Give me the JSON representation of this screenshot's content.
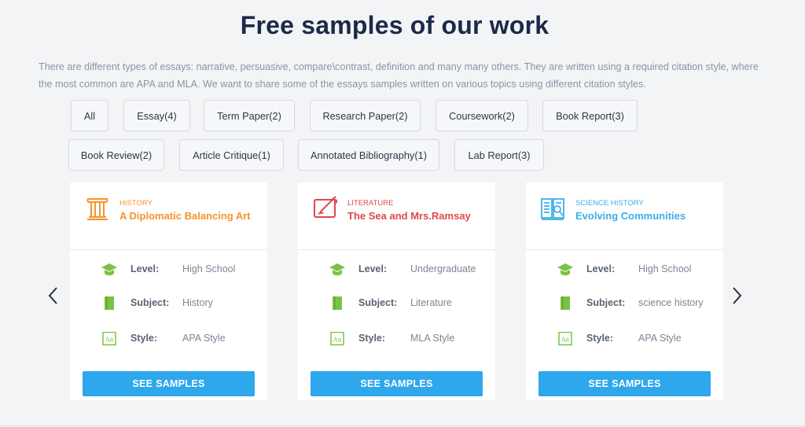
{
  "heading": "Free samples of our work",
  "intro": "There are different types of essays: narrative, persuasive, compare\\contrast, definition and many many others. They are written using a required citation style, where the most common are APA and MLA. We want to share some of the essays samples written on various topics using different citation styles.",
  "filters": [
    {
      "label": "All"
    },
    {
      "label": "Essay(4)"
    },
    {
      "label": "Term Paper(2)"
    },
    {
      "label": "Research Paper(2)"
    },
    {
      "label": "Coursework(2)"
    },
    {
      "label": "Book Report(3)"
    },
    {
      "label": "Book Review(2)"
    },
    {
      "label": "Article Critique(1)"
    },
    {
      "label": "Annotated Bibliography(1)"
    },
    {
      "label": "Lab Report(3)"
    }
  ],
  "labels": {
    "level": "Level:",
    "subject": "Subject:",
    "style": "Style:"
  },
  "cards": [
    {
      "category": "HISTORY",
      "title": "A Diplomatic Balancing Art",
      "level": "High School",
      "subject": "History",
      "style": "APA Style",
      "button": "SEE SAMPLES",
      "accent": "#f6922e",
      "icon": "column-icon"
    },
    {
      "category": "LITERATURE",
      "title": "The Sea and Mrs.Ramsay",
      "level": "Undergraduate",
      "subject": "Literature",
      "style": "MLA Style",
      "button": "SEE SAMPLES",
      "accent": "#e0474c",
      "icon": "scroll-quill-icon"
    },
    {
      "category": "SCIENCE HISTORY",
      "title": "Evolving Communities",
      "level": "High School",
      "subject": "science history",
      "style": "APA Style",
      "button": "SEE SAMPLES",
      "accent": "#3aaee8",
      "icon": "book-magnifier-icon"
    }
  ],
  "colors": {
    "green": "#7cc242",
    "button": "#2ea7ec",
    "title": "#1c2a48"
  }
}
